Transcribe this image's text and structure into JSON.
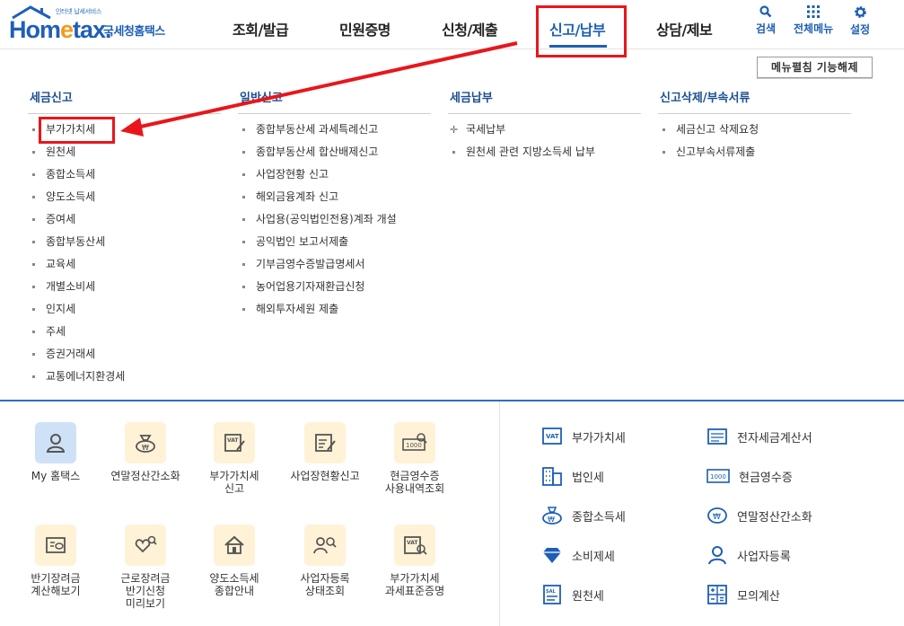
{
  "logo": {
    "sub": "인터넷 납세서비스",
    "brand_a": "Hom",
    "brand_e": "e",
    "brand_b": "tax.",
    "korean": "국세청홈택스"
  },
  "nav": [
    {
      "label": "조회/발급"
    },
    {
      "label": "민원증명"
    },
    {
      "label": "신청/제출"
    },
    {
      "label": "신고/납부"
    },
    {
      "label": "상담/제보"
    }
  ],
  "utilities": {
    "search": "검색",
    "all_menu": "전체메뉴",
    "settings": "설정"
  },
  "collapse_button": "메뉴펼침 기능해제",
  "columns": [
    {
      "title": "세금신고",
      "items": [
        "부가가치세",
        "원천세",
        "종합소득세",
        "양도소득세",
        "증여세",
        "종합부동산세",
        "교육세",
        "개별소비세",
        "인지세",
        "주세",
        "증권거래세",
        "교통에너지환경세"
      ]
    },
    {
      "title": "일반신고",
      "items": [
        "종합부동산세 과세특례신고",
        "종합부동산세 합산배제신고",
        "사업장현황 신고",
        "해외금융계좌 신고",
        "사업용(공익법인전용)계좌 개설",
        "공익법인 보고서제출",
        "기부금영수증발급명세서",
        "농어업용기자재환급신청",
        "해외투자세원 제출"
      ]
    },
    {
      "title": "세금납부",
      "items": [
        "국세납부",
        "원천세 관련 지방소득세 납부"
      ]
    },
    {
      "title": "신고삭제/부속서류",
      "items": [
        "세금신고 삭제요청",
        "신고부속서류제출"
      ]
    }
  ],
  "tiles": [
    {
      "label": "My 홈택스"
    },
    {
      "label": "연말정산간소화"
    },
    {
      "label": "부가가치세\n신고"
    },
    {
      "label": "사업장현황신고"
    },
    {
      "label": "현금영수증\n사용내역조회"
    },
    {
      "label": "반기장려금\n계산해보기"
    },
    {
      "label": "근로장려금\n반기신청\n미리보기"
    },
    {
      "label": "양도소득세\n종합안내"
    },
    {
      "label": "사업자등록\n상태조회"
    },
    {
      "label": "부가가치세\n과세표준증명"
    }
  ],
  "services": [
    {
      "label": "부가가치세"
    },
    {
      "label": "전자세금계산서"
    },
    {
      "label": "법인세"
    },
    {
      "label": "현금영수증"
    },
    {
      "label": "종합소득세"
    },
    {
      "label": "연말정산간소화"
    },
    {
      "label": "소비제세"
    },
    {
      "label": "사업자등록"
    },
    {
      "label": "원천세"
    },
    {
      "label": "모의계산"
    }
  ],
  "icon_names": [
    "house-roof-icon",
    "search-icon",
    "grid-menu-icon",
    "gear-icon",
    "arrow-annotation"
  ],
  "colors": {
    "brand_blue": "#1d5fb6",
    "highlight_red": "#e8161b",
    "tile_yellow": "#fff2d6",
    "tile_blue": "#cfe1f6"
  }
}
